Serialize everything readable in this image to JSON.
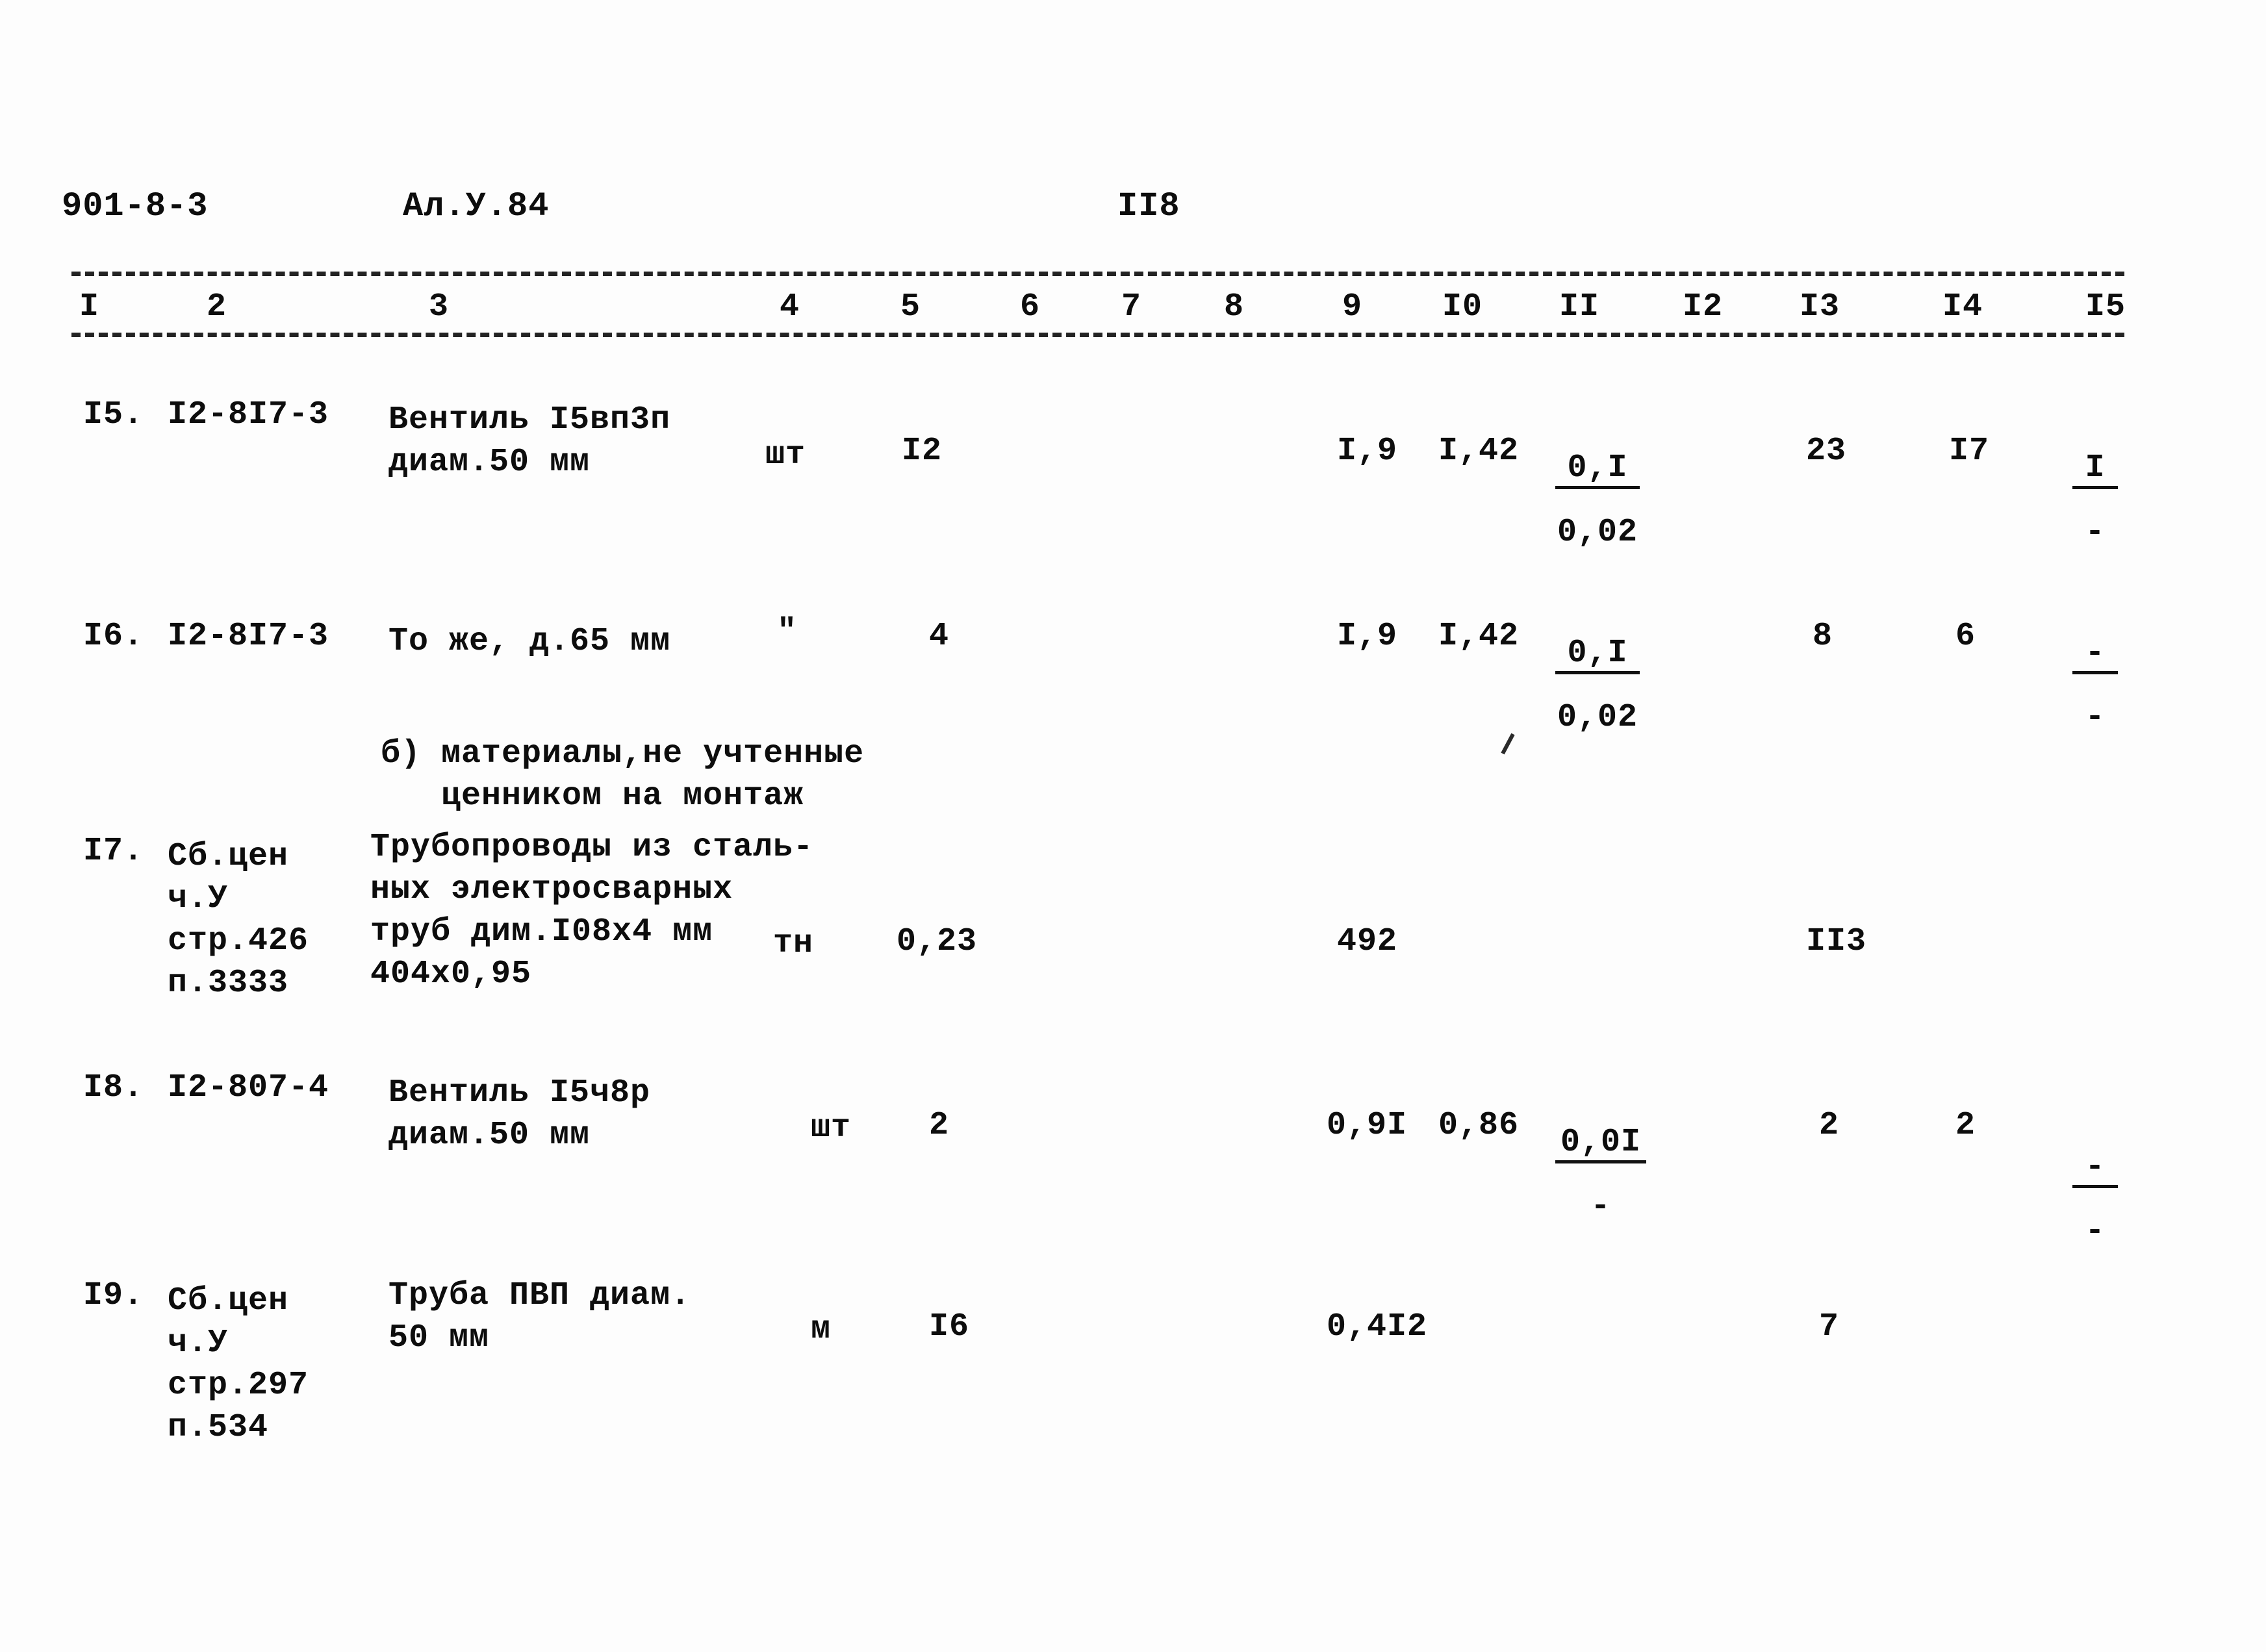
{
  "header": {
    "doc_code": "901-8-3",
    "sheet_code": "Ал.У.84",
    "page_number": "II8"
  },
  "table": {
    "column_numbers": [
      "I",
      "2",
      "3",
      "4",
      "5",
      "6",
      "7",
      "8",
      "9",
      "I0",
      "II",
      "I2",
      "I3",
      "I4",
      "I5"
    ],
    "section_note": "б) материалы,не учтенные\n   ценником на монтаж",
    "rows": [
      {
        "num": "I5.",
        "code": "I2-8I7-3",
        "description": "Вентиль I5вп3п\nдиам.50 мм",
        "unit": "шт",
        "qty": "I2",
        "c9": "I,9",
        "c10": "I,42",
        "c11_num": "0,I",
        "c11_den": "0,02",
        "c13": "23",
        "c14": "I7",
        "c15_num": "I",
        "c15_den": "-"
      },
      {
        "num": "I6.",
        "code": "I2-8I7-3",
        "description": "То же, д.65 мм",
        "unit": "\"",
        "qty": "4",
        "c9": "I,9",
        "c10": "I,42",
        "c11_num": "0,I",
        "c11_den": "0,02",
        "c13": "8",
        "c14": "6",
        "c15_num": "-",
        "c15_den": "-"
      },
      {
        "num": "I7.",
        "code": "Сб.цен\nч.У\nстр.426\nп.3333",
        "description": "Трубопроводы из сталь-\nных электросварных\nтруб дим.I08х4 мм\n404х0,95",
        "unit": "тн",
        "qty": "0,23",
        "c9": "492",
        "c10": "",
        "c11_num": "",
        "c11_den": "",
        "c13": "II3",
        "c14": "",
        "c15_num": "",
        "c15_den": ""
      },
      {
        "num": "I8.",
        "code": "I2-807-4",
        "description": "Вентиль I5ч8р\nдиам.50 мм",
        "unit": "шт",
        "qty": "2",
        "c9": "0,9I",
        "c10": "0,86",
        "c11_num": "0,0I",
        "c11_den": "-",
        "c13": "2",
        "c14": "2",
        "c15_num": "-",
        "c15_den": "-"
      },
      {
        "num": "I9.",
        "code": "Сб.цен\nч.У\nстр.297\nп.534",
        "description": "Труба ПВП диам.\n50 мм",
        "unit": "м",
        "qty": "I6",
        "c9": "0,4I2",
        "c10": "",
        "c11_num": "",
        "c11_den": "",
        "c13": "7",
        "c14": "",
        "c15_num": "",
        "c15_den": ""
      }
    ]
  }
}
